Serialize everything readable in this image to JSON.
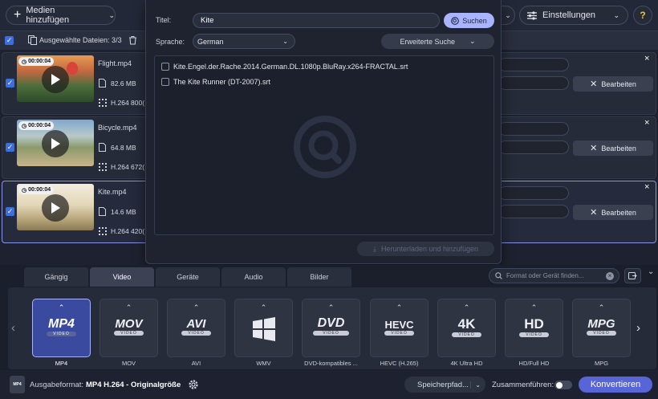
{
  "toolbar": {
    "add_media": "Medien hinzufügen",
    "settings": "Einstellungen",
    "help": "?"
  },
  "selection": {
    "label": "Ausgewählte Dateien: 3/3"
  },
  "files": [
    {
      "duration": "00:00:04",
      "name": "Flight.mp4",
      "size": "82.6 MB",
      "codec": "H.264 800("
    },
    {
      "duration": "00:00:04",
      "name": "Bicycle.mp4",
      "size": "64.8 MB",
      "codec": "H.264 672("
    },
    {
      "duration": "00:00:04",
      "name": "Kite.mp4",
      "size": "14.6 MB",
      "codec": "H.264 420("
    }
  ],
  "edit_label": "Bearbeiten",
  "subtitle_search": {
    "title_label": "Titel:",
    "title_value": "Kite",
    "search_button": "Suchen",
    "language_label": "Sprache:",
    "language_value": "German",
    "advanced_search": "Erweiterte Suche",
    "results": [
      "Kite.Engel.der.Rache.2014.German.DL.1080p.BluRay.x264-FRACTAL.srt",
      "The Kite Runner (DT-2007).srt"
    ],
    "download_button": "Herunterladen und hinzufügen"
  },
  "format_tabs": [
    "Gängig",
    "Video",
    "Geräte",
    "Audio",
    "Bilder"
  ],
  "format_search_placeholder": "Format oder Gerät finden...",
  "formats": [
    {
      "logo": "MP4",
      "label": "MP4"
    },
    {
      "logo": "MOV",
      "label": "MOV"
    },
    {
      "logo": "AVI",
      "label": "AVI"
    },
    {
      "logo": "",
      "label": "WMV"
    },
    {
      "logo": "DVD",
      "label": "DVD-kompatibles ..."
    },
    {
      "logo": "HEVC",
      "label": "HEVC (H.265)"
    },
    {
      "logo": "4K",
      "label": "4K Ultra HD"
    },
    {
      "logo": "HD",
      "label": "HD/Full HD"
    },
    {
      "logo": "MPG",
      "label": "MPG"
    }
  ],
  "format_sub": "VIDEO",
  "output": {
    "label": "Ausgabeformat:",
    "value": "MP4 H.264 - Originalgröße",
    "badge": "MP4",
    "save_path": "Speicherpfad...",
    "merge": "Zusammenführen:",
    "convert": "Konvertieren"
  },
  "colors": {
    "accent": "#3d6ee0",
    "convert": "#5865d6",
    "active_card": "#3a4a9e",
    "search_button": "#a9b4ff"
  }
}
